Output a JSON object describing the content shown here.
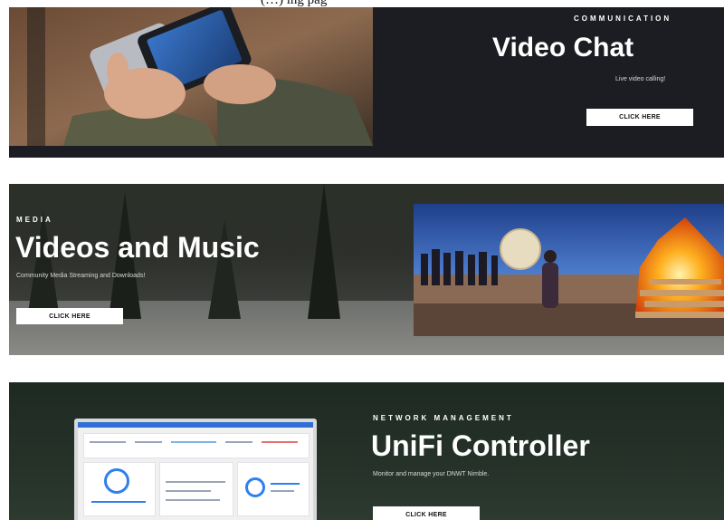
{
  "page": {
    "top_text": "(…) ing pag"
  },
  "panels": [
    {
      "eyebrow": "COMMUNICATION",
      "title": "Video Chat",
      "description": "Live video calling!",
      "button_label": "CLICK HERE",
      "image_alt": "Hands holding smartphones"
    },
    {
      "eyebrow": "MEDIA",
      "title": "Videos and Music",
      "description": "Community Media Streaming and Downloads!",
      "button_label": "CLICK HERE",
      "image_alt": "Drummer beside a bonfire at night"
    },
    {
      "eyebrow": "NETWORK MANAGEMENT",
      "title": "UniFi Controller",
      "description": "Monitor and manage your DNWT Nimble.",
      "button_label": "CLICK HERE",
      "image_alt": "Tablet showing UniFi dashboard"
    }
  ],
  "colors": {
    "panel_dark": "#1b1d22",
    "button_bg": "#ffffff",
    "text_light": "#ffffff"
  }
}
